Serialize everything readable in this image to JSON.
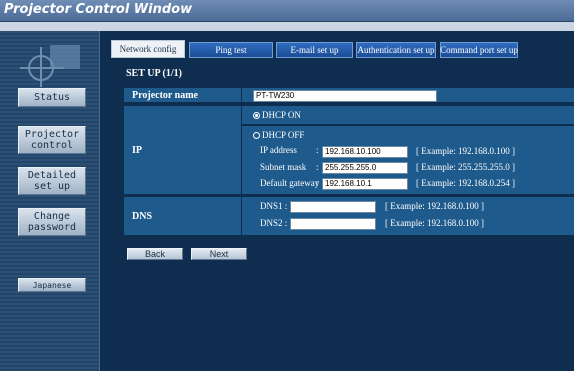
{
  "window": {
    "title": "Projector Control Window"
  },
  "sidebar": {
    "buttons": [
      {
        "id": "status",
        "label": "Status"
      },
      {
        "id": "projector-control",
        "label": "Projector\ncontrol"
      },
      {
        "id": "detailed-set-up",
        "label": "Detailed\nset up"
      },
      {
        "id": "change-password",
        "label": "Change\npassword"
      },
      {
        "id": "japanese",
        "label": "Japanese"
      }
    ]
  },
  "tabs": [
    {
      "label": "Network config",
      "active": true
    },
    {
      "label": "Ping test",
      "active": false
    },
    {
      "label": "E-mail set up",
      "active": false
    },
    {
      "label": "Authentication set up",
      "active": false
    },
    {
      "label": "Command port set up",
      "active": false
    }
  ],
  "setup_title": "SET UP (1/1)",
  "form": {
    "projector_name": {
      "label": "Projector name",
      "value": "PT-TW230"
    },
    "ip": {
      "label": "IP",
      "dhcp_on": {
        "label": "DHCP ON",
        "selected": true
      },
      "dhcp_off": {
        "label": "DHCP OFF",
        "selected": false
      },
      "ip_address": {
        "label": "IP address",
        "sep": ":",
        "value": "192.168.10.100",
        "example": "[ Example: 192.168.0.100 ]"
      },
      "subnet_mask": {
        "label": "Subnet mask",
        "sep": ":",
        "value": "255.255.255.0",
        "example": "[ Example: 255.255.255.0 ]"
      },
      "default_gateway": {
        "label": "Default gateway",
        "sep": ":",
        "value": "192.168.10.1",
        "example": "[ Example: 192.168.0.254 ]"
      }
    },
    "dns": {
      "label": "DNS",
      "dns1": {
        "label": "DNS1 :",
        "value": "",
        "example": "[ Example: 192.168.0.100 ]"
      },
      "dns2": {
        "label": "DNS2 :",
        "value": "",
        "example": "[ Example: 192.168.0.100 ]"
      }
    }
  },
  "actions": {
    "back": "Back",
    "next": "Next"
  }
}
